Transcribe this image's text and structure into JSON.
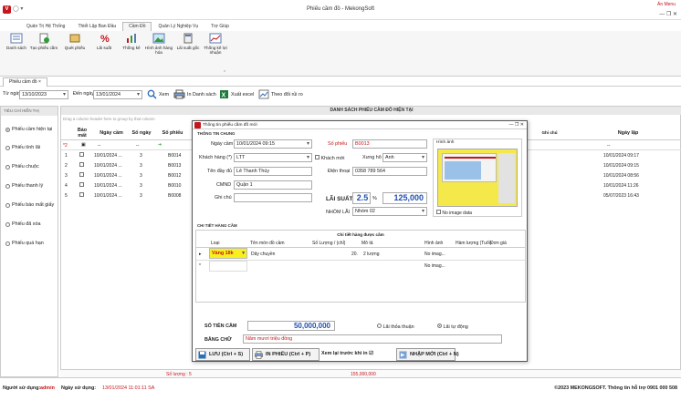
{
  "window": {
    "title": "Phiếu cầm đồ - MekongSoft",
    "brand": "Ẩn Menu",
    "controls": "— ❐ ✕"
  },
  "menu": [
    "Quản Trị Hệ Thống",
    "Thiết Lập Ban Đầu",
    "Cầm Đồ",
    "Quản Lý Nghiệp Vụ",
    "Trợ Giúp"
  ],
  "ribbon": [
    "Danh sách",
    "Tạo phiếu cầm",
    "Quét phiếu",
    "Lãi suất",
    "Thống kê",
    "Hình ảnh hàng hóa",
    "Lãi suất gốc",
    "Thống kê lợi nhuận"
  ],
  "tab": "Phiếu cầm đồ",
  "toolbar": {
    "from_label": "Từ ngày",
    "from": "13/10/2023",
    "to_label": "Đến ngày",
    "to": "13/01/2024",
    "search": "Xem",
    "print": "In Danh sách",
    "excel": "Xuất excel",
    "rate": "Theo đổi rủi ro"
  },
  "sidebar": {
    "header": "TIÊU CHÍ HIỂN THỊ",
    "items": [
      "Phiếu cầm hiện tại",
      "Phiếu tính lãi",
      "Phiếu chuộc",
      "Phiếu thanh lý",
      "Phiếu báo mất giấy",
      "Phiếu đã xóa",
      "Phiếu quá hạn"
    ]
  },
  "grid": {
    "title": "DANH SÁCH PHIẾU CẦM ĐỒ HIỆN TẠI",
    "group_hint": "Drag a column header here to group by that column",
    "headers": [
      "Báo mất",
      "Ngày cầm",
      "Số ngày",
      "Số phiếu",
      "Ghi chú",
      "Ngày lập"
    ],
    "filter": {
      "rownum": "*2",
      "dash": "--"
    },
    "rows": [
      {
        "n": "1",
        "date": "10/01/2024 ...",
        "days": "3",
        "no": "B0014",
        "created": "10/01/2024 09:17"
      },
      {
        "n": "2",
        "date": "10/01/2024 ...",
        "days": "3",
        "no": "B0013",
        "created": "10/01/2024 09:15"
      },
      {
        "n": "3",
        "date": "10/01/2024 ...",
        "days": "3",
        "no": "B0012",
        "created": "10/01/2024 08:56"
      },
      {
        "n": "4",
        "date": "10/01/2024 ...",
        "days": "3",
        "no": "B0010",
        "created": "10/01/2024 11:26"
      },
      {
        "n": "5",
        "date": "10/01/2024 ...",
        "days": "3",
        "no": "B0008",
        "created": "05/07/2023 16:43"
      }
    ],
    "footer_count": "Số lượng : 5",
    "footer_total": "155,000,000"
  },
  "dialog": {
    "title": "Thông tin phiếu cầm đồ mới",
    "general": "THÔNG TIN CHUNG",
    "date_label": "Ngày cầm",
    "date": "10/01/2024 09:15",
    "ticket_label": "Số phiếu",
    "ticket": "B0013",
    "customer_label": "Khách hàng (*)",
    "customer": "LTT",
    "new_customer": "Khách mới",
    "title_label": "Xưng hô",
    "title_val": "Anh",
    "name_label": "Tên đầy đủ",
    "name": "Lê Thanh Thúy",
    "phone_label": "Điện thoại",
    "phone": "0358 789 564",
    "id_label": "CMND",
    "id": "Quận 1",
    "note_label": "Ghi chú",
    "rate_label": "LÃI SUẤT",
    "rate": "2.5",
    "pct": "%",
    "rate_amount": "125,000",
    "group_label": "NHÓM LÃI",
    "group": "Nhóm 02",
    "image_title": "Hình ảnh",
    "no_image": "No image data",
    "detail": "CHI TIẾT HÀNG CẦM",
    "detail_sub": "Chi tiết hàng được cầm",
    "cols": [
      "Loại",
      "Tên món đồ cầm",
      "Số Lượng / (chỉ)",
      "Mô tả",
      "Hình ảnh",
      "Hàm lượng (Tuổi)",
      "Đơn giá"
    ],
    "item": {
      "type": "Vàng 18k",
      "name": "Dây chuyền",
      "qty": "20.",
      "desc": "2 lượng",
      "img": "No imag..."
    },
    "item2_img": "No imag...",
    "amount_label": "SỐ TIỀN CẦM",
    "amount": "50,000,000",
    "agree": "Lãi thỏa thuận",
    "auto": "Lãi tự động",
    "words_label": "BẰNG CHỮ",
    "words": "Năm mươi triệu đồng",
    "save": "LƯU (Ctrl + S)",
    "print": "IN PHIẾU (Ctrl + P)",
    "preview": "Xem lại trước khi in",
    "new": "NHẬP MỚI (Ctrl + N)"
  },
  "status": {
    "user_label": "Người sử dụng:",
    "user": "admin",
    "date_label": "Ngày sử dụng:",
    "date": "13/01/2024 11:01:11 SA",
    "copyright": "©2023 MEKONGSOFT. Thông tin hỗ trợ 0901 000 508"
  },
  "colors": {
    "red": "#c4161c",
    "green": "#2e9d3a"
  }
}
